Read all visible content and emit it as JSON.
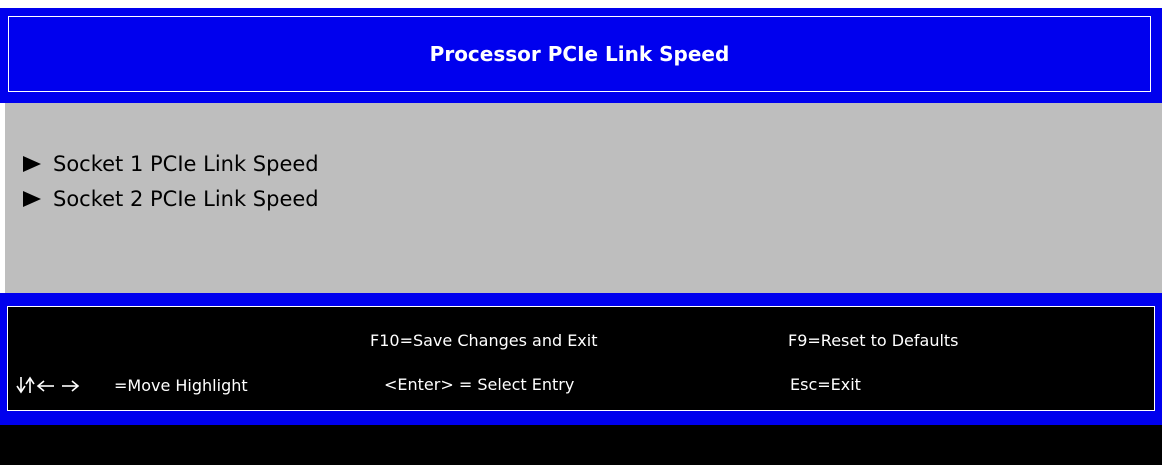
{
  "title": "Processor PCIe Link Speed",
  "menu": {
    "items": [
      {
        "label": "Socket 1 PCIe Link Speed"
      },
      {
        "label": "Socket 2 PCIe Link Speed"
      }
    ]
  },
  "footer": {
    "save_exit": "F10=Save Changes and Exit",
    "reset_defaults": "F9=Reset to Defaults",
    "move_highlight": "=Move Highlight",
    "select_entry": "<Enter> = Select Entry",
    "esc_exit": "Esc=Exit"
  },
  "colors": {
    "band_blue": "#0000ee",
    "content_gray": "#bebebe",
    "footer_black": "#000000",
    "text_white": "#ffffff"
  }
}
